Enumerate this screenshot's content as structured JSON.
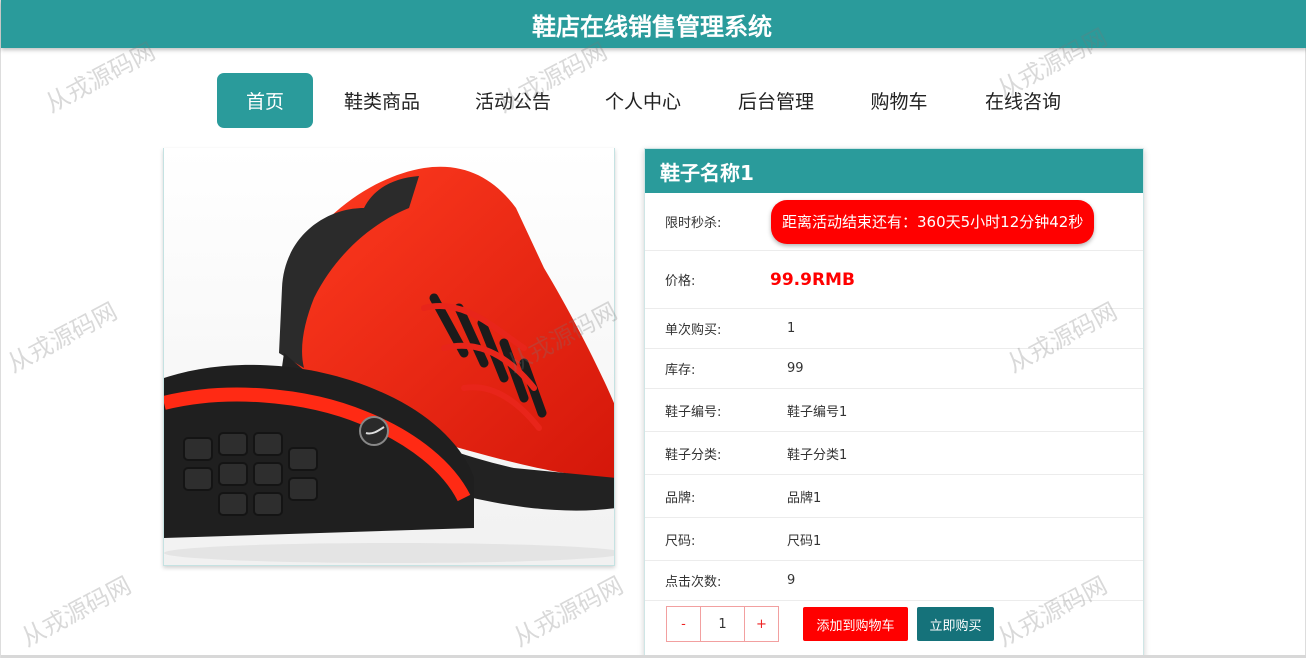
{
  "header": {
    "title": "鞋店在线销售管理系统"
  },
  "nav": {
    "items": [
      {
        "label": "首页",
        "active": true
      },
      {
        "label": "鞋类商品"
      },
      {
        "label": "活动公告"
      },
      {
        "label": "个人中心"
      },
      {
        "label": "后台管理"
      },
      {
        "label": "购物车"
      },
      {
        "label": "在线咨询"
      }
    ]
  },
  "product": {
    "name": "鞋子名称1",
    "image_icon": "red-running-shoe-image",
    "flash_sale": {
      "label": "限时秒杀:",
      "countdown": "距离活动结束还有：360天5小时12分钟42秒"
    },
    "price": {
      "label": "价格:",
      "value": "99.9RMB"
    },
    "per_purchase": {
      "label": "单次购买:",
      "value": "1"
    },
    "stock": {
      "label": "库存:",
      "value": "99"
    },
    "number": {
      "label": "鞋子编号:",
      "value": "鞋子编号1"
    },
    "category": {
      "label": "鞋子分类:",
      "value": "鞋子分类1"
    },
    "brand": {
      "label": "品牌:",
      "value": "品牌1"
    },
    "size": {
      "label": "尺码:",
      "value": "尺码1"
    },
    "clicks": {
      "label": "点击次数:",
      "value": "9"
    }
  },
  "actions": {
    "minus": "-",
    "quantity": "1",
    "plus": "+",
    "add_to_cart": "添加到购物车",
    "buy_now": "立即购买"
  },
  "watermark": "从戎源码网",
  "colors": {
    "primary": "#2a9b9b",
    "danger": "#ff0000",
    "buy": "#15727a"
  }
}
